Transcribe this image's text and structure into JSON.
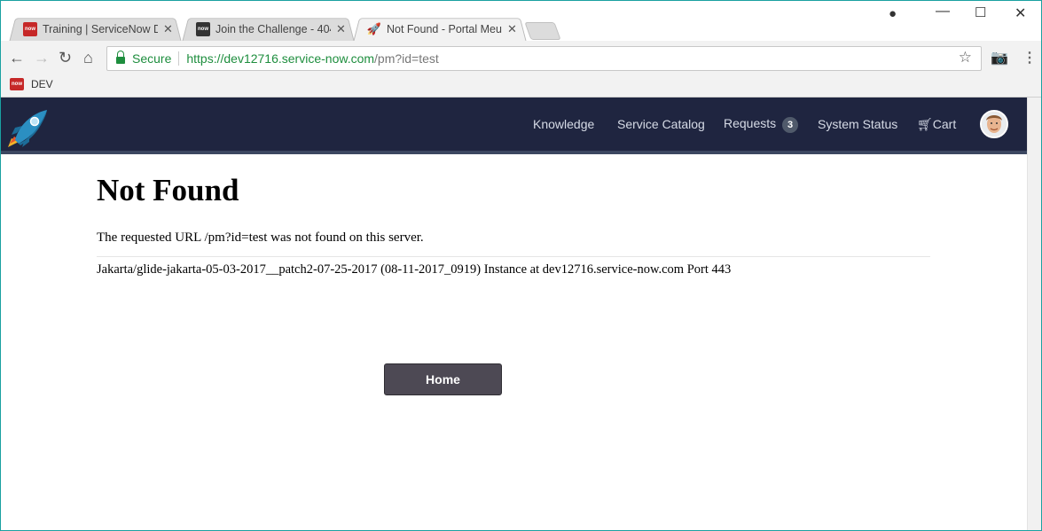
{
  "browser": {
    "tabs": [
      {
        "title": "Training | ServiceNow De",
        "favicon": "now"
      },
      {
        "title": "Join the Challenge - 404",
        "favicon": "now"
      },
      {
        "title": "Not Found - Portal Meun",
        "favicon": "rocket-icon"
      }
    ],
    "omnibox": {
      "secure_label": "Secure",
      "url_host": "https://dev12716.service-now.com",
      "url_path": "/pm?id=test"
    },
    "bookmarks": [
      {
        "label": "DEV",
        "favicon": "now"
      }
    ]
  },
  "portal": {
    "nav": {
      "knowledge": "Knowledge",
      "service_catalog": "Service Catalog",
      "requests": "Requests",
      "requests_count": "3",
      "system_status": "System Status",
      "cart": "Cart"
    },
    "colors": {
      "header_bg": "#1f2540",
      "button_bg": "#4d4954"
    }
  },
  "page": {
    "heading": "Not Found",
    "message": "The requested URL /pm?id=test was not found on this server.",
    "signature": "Jakarta/glide-jakarta-05-03-2017__patch2-07-25-2017 (08-11-2017_0919) Instance at dev12716.service-now.com Port 443",
    "home_button": "Home"
  }
}
